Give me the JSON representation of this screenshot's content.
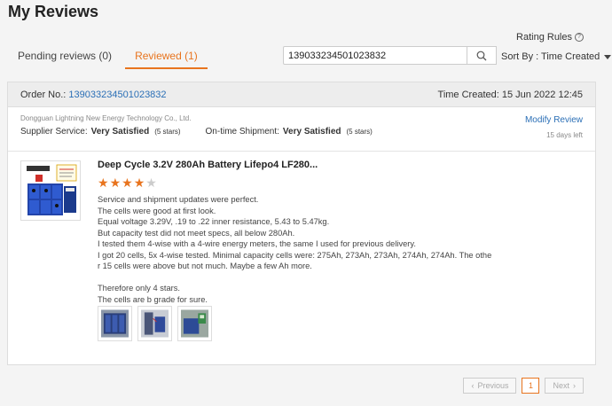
{
  "page": {
    "title": "My Reviews"
  },
  "rating_rules": {
    "label": "Rating Rules",
    "icon": "question-circle-icon"
  },
  "tabs": [
    {
      "label": "Pending reviews (0)",
      "active": false
    },
    {
      "label": "Reviewed (1)",
      "active": true
    }
  ],
  "search": {
    "value": "139033234501023832",
    "icon": "search-icon"
  },
  "sort": {
    "label": "Sort By : Time Created",
    "icon": "caret-down-icon"
  },
  "order": {
    "label": "Order No.:",
    "number": "139033234501023832",
    "time_created": "Time Created: 15 Jun 2022 12:45"
  },
  "supplier": {
    "name": "Dongguan Lightning New Energy Technology Co., Ltd.",
    "service_label": "Supplier Service:",
    "service_value": "Very Satisfied",
    "service_stars": "(5 stars)",
    "shipment_label": "On-time Shipment:",
    "shipment_value": "Very Satisfied",
    "shipment_stars": "(5 stars)",
    "modify_label": "Modify Review",
    "days_left": "15 days left"
  },
  "product": {
    "title": "Deep Cycle 3.2V 280Ah Battery Lifepo4 LF280...",
    "rating": 4,
    "max_rating": 5,
    "accent": "#e8741e"
  },
  "review": {
    "lines": [
      "Service and shipment updates were perfect.",
      "The cells were good at first look.",
      "Equal voltage 3.29V, .19 to .22 inner resistance, 5.43 to 5.47kg.",
      "But capacity test did not meet specs, all below 280Ah.",
      "I tested them 4-wise with a 4-wire energy meters, the same I used for previous delivery.",
      "I got 20 cells, 5x 4-wise tested. Minimal capacity cells were: 275Ah, 273Ah, 273Ah, 274Ah, 274Ah. The othe",
      "r 15 cells were above but not much. Maybe a few Ah more."
    ],
    "lines2": [
      "Therefore only 4 stars.",
      "The cells are b grade for sure."
    ]
  },
  "pagination": {
    "prev": "Previous",
    "current": "1",
    "next": "Next"
  }
}
